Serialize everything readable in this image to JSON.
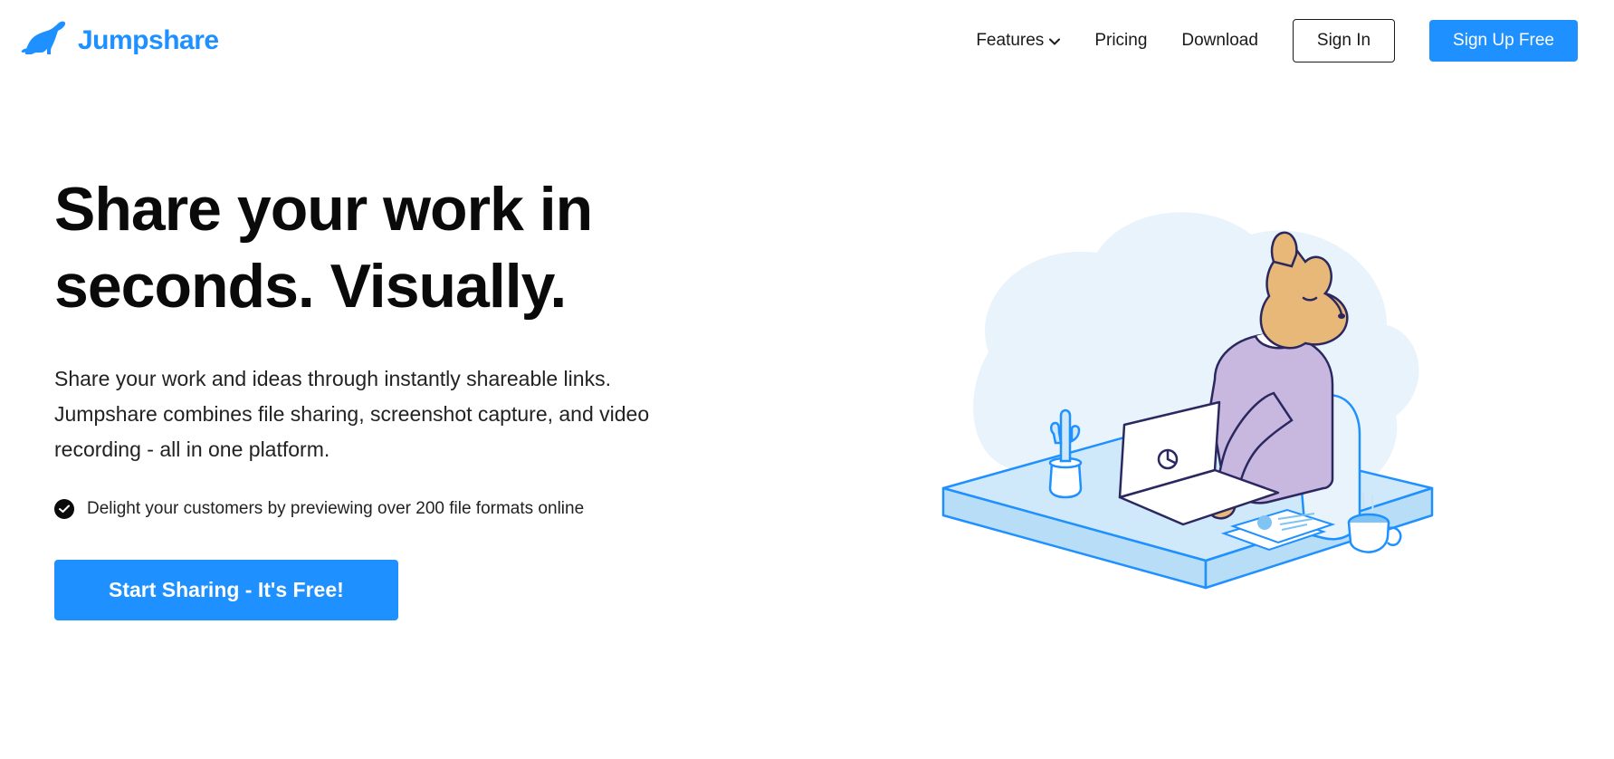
{
  "brand": {
    "name": "Jumpshare",
    "accent_color": "#1e90ff"
  },
  "nav": {
    "features": "Features",
    "pricing": "Pricing",
    "download": "Download",
    "sign_in": "Sign In",
    "sign_up": "Sign Up Free"
  },
  "hero": {
    "title": "Share your work in seconds. Visually.",
    "subtitle": "Share your work and ideas through instantly shareable links. Jumpshare combines file sharing, screenshot capture, and video recording - all in one platform.",
    "note": "Delight your customers by previewing over 200 file formats online",
    "cta": "Start Sharing - It's Free!"
  }
}
